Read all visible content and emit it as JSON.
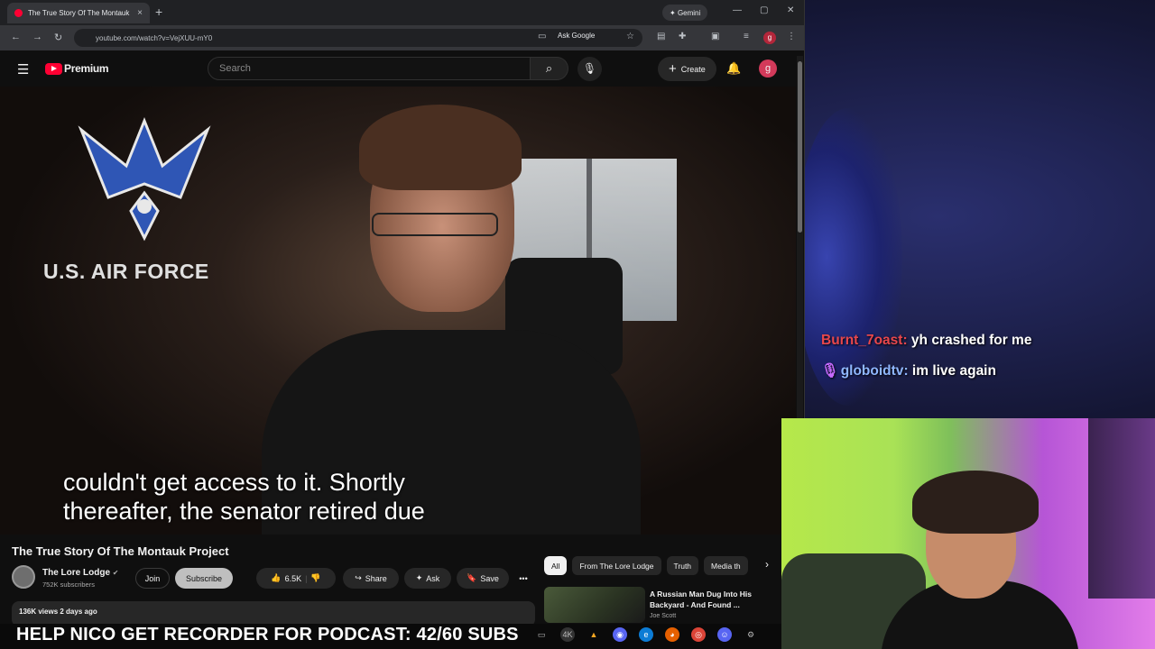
{
  "browser": {
    "tab_title": "The True Story Of The Montauk",
    "tab_close": "×",
    "new_tab": "+",
    "gemini_label": "Gemini",
    "url": "youtube.com/watch?v=VejXUU-mY0",
    "ask_google": "Ask Google",
    "profile_initial": "g"
  },
  "youtube": {
    "logo_text": "Premium",
    "search_placeholder": "Search",
    "create_label": "Create",
    "avatar_initial": "g"
  },
  "video": {
    "overlay_logo_text": "U.S. AIR FORCE",
    "caption_line1": "couldn't get access to it. Shortly",
    "caption_line2": "thereafter, the senator retired due",
    "title": "The True Story Of The Montauk Project",
    "channel_name": "The Lore Lodge",
    "subscribers": "752K subscribers",
    "join_label": "Join",
    "subscribe_label": "Subscribe",
    "likes": "6.5K",
    "share_label": "Share",
    "ask_label": "Ask",
    "save_label": "Save",
    "views_date": "136K views  2 days ago"
  },
  "chips": [
    "All",
    "From The Lore Lodge",
    "Truth",
    "Media th"
  ],
  "recommendation": {
    "title": "A Russian Man Dug Into His Backyard - And Found ...",
    "channel": "Joe Scott"
  },
  "chat": [
    {
      "user": "Burnt_7oast",
      "message": "yh crashed for me"
    },
    {
      "user": "globoidtv",
      "message": "im live again"
    }
  ],
  "banner": {
    "text": "HELP NICO GET RECORDER FOR PODCAST: 42/60 SUBS"
  },
  "colors": {
    "youtube_red": "#ff0033",
    "chat_user1": "#e8474c",
    "chat_user2": "#8fb7ff",
    "bg_dark": "#0f0f0f"
  }
}
